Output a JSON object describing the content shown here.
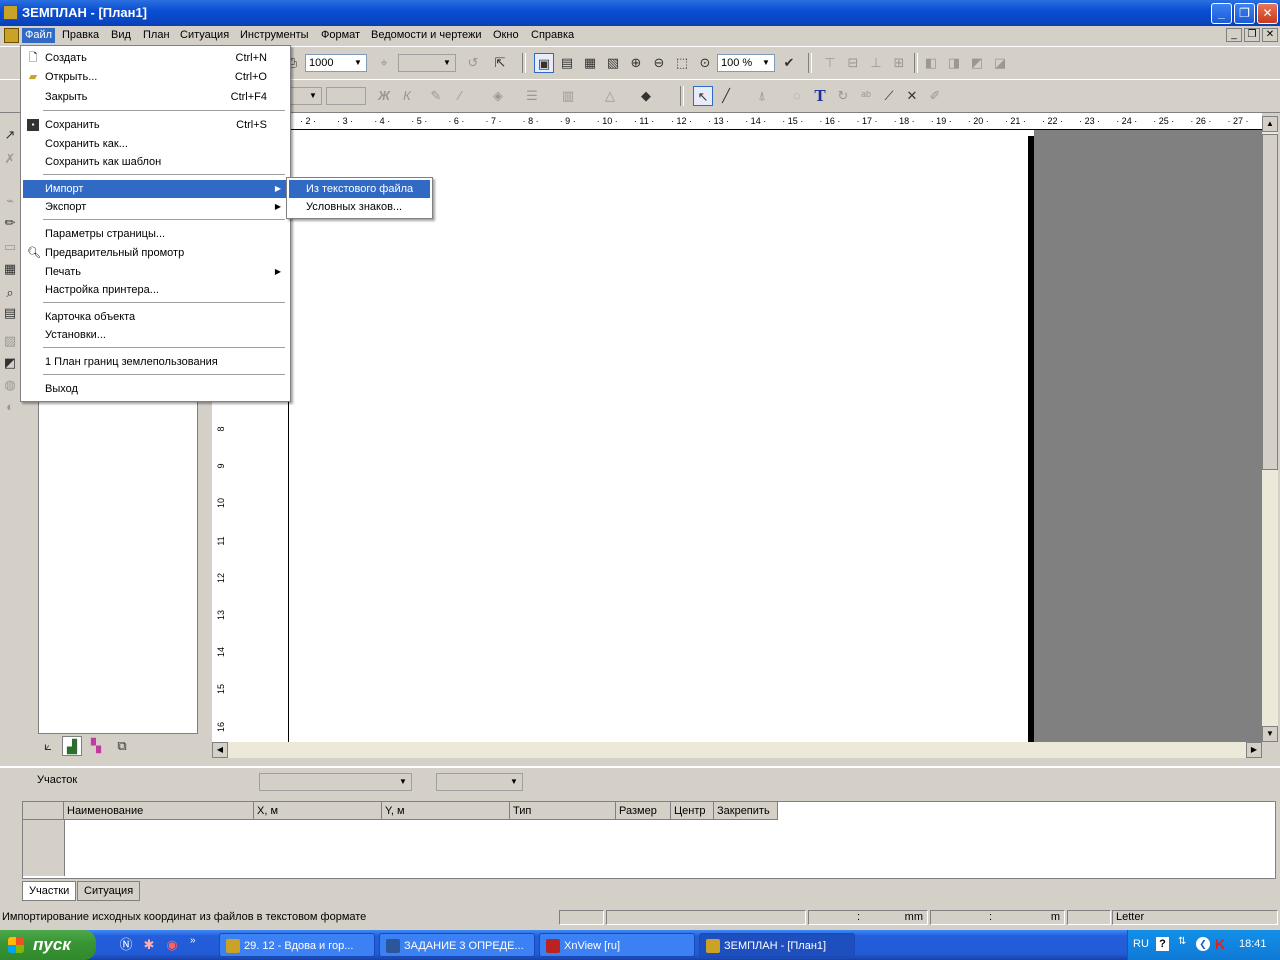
{
  "window": {
    "title": "ЗЕМПЛАН - [План1]"
  },
  "menubar": [
    "Файл",
    "Правка",
    "Вид",
    "План",
    "Ситуация",
    "Инструменты",
    "Формат",
    "Ведомости и чертежи",
    "Окно",
    "Справка"
  ],
  "toolbar": {
    "scale_value": "1000",
    "zoom_value": "100 %"
  },
  "file_menu": [
    {
      "label": "Создать",
      "shortcut": "Ctrl+N",
      "icon": "new-doc-icon"
    },
    {
      "label": "Открыть...",
      "shortcut": "Ctrl+O",
      "icon": "open-folder-icon"
    },
    {
      "label": "Закрыть",
      "shortcut": "Ctrl+F4"
    },
    {
      "label": "Сохранить",
      "shortcut": "Ctrl+S",
      "icon": "save-icon"
    },
    {
      "label": "Сохранить как..."
    },
    {
      "label": "Сохранить как шаблон"
    },
    {
      "label": "Импорт",
      "submenu": true
    },
    {
      "label": "Экспорт",
      "submenu": true
    },
    {
      "label": "Параметры страницы..."
    },
    {
      "label": "Предварительный промотр",
      "icon": "print-preview-icon"
    },
    {
      "label": "Печать",
      "submenu": true
    },
    {
      "label": "Настройка принтера..."
    },
    {
      "label": "Карточка объекта"
    },
    {
      "label": "Установки..."
    },
    {
      "label": "1 План границ землепользования"
    },
    {
      "label": "Выход"
    }
  ],
  "import_submenu": [
    "Из текстового файла",
    "Условных знаков..."
  ],
  "ruler": {
    "h_ticks": [
      "2",
      "3",
      "4",
      "5",
      "6",
      "7",
      "8",
      "9",
      "10",
      "11",
      "12",
      "13",
      "14",
      "15",
      "16",
      "17",
      "18",
      "19",
      "20",
      "21",
      "22",
      "23",
      "24",
      "25",
      "26",
      "27"
    ],
    "v_ticks": [
      "8",
      "9",
      "10",
      "11",
      "12",
      "13",
      "14",
      "15",
      "16"
    ]
  },
  "bottom": {
    "parcel_label": "Участок",
    "columns": [
      "Наименование",
      "X, м",
      "Y, м",
      "Тип",
      "Размер",
      "Центр",
      "Закрепить"
    ],
    "tabs": [
      "Участки",
      "Ситуация"
    ]
  },
  "status": {
    "message": "Импортирование исходных координат из файлов в текстовом формате",
    "coord_sep1": ":",
    "unit1": "mm",
    "coord_sep2": ":",
    "unit2": "m",
    "paper": "Letter"
  },
  "taskbar": {
    "start": "пуск",
    "tasks": [
      "29. 12 - Вдова и гор...",
      "ЗАДАНИЕ 3 ОПРЕДЕ...",
      "XnView [ru]",
      "ЗЕМПЛАН - [План1]"
    ],
    "lang": "RU",
    "time": "18:41"
  }
}
